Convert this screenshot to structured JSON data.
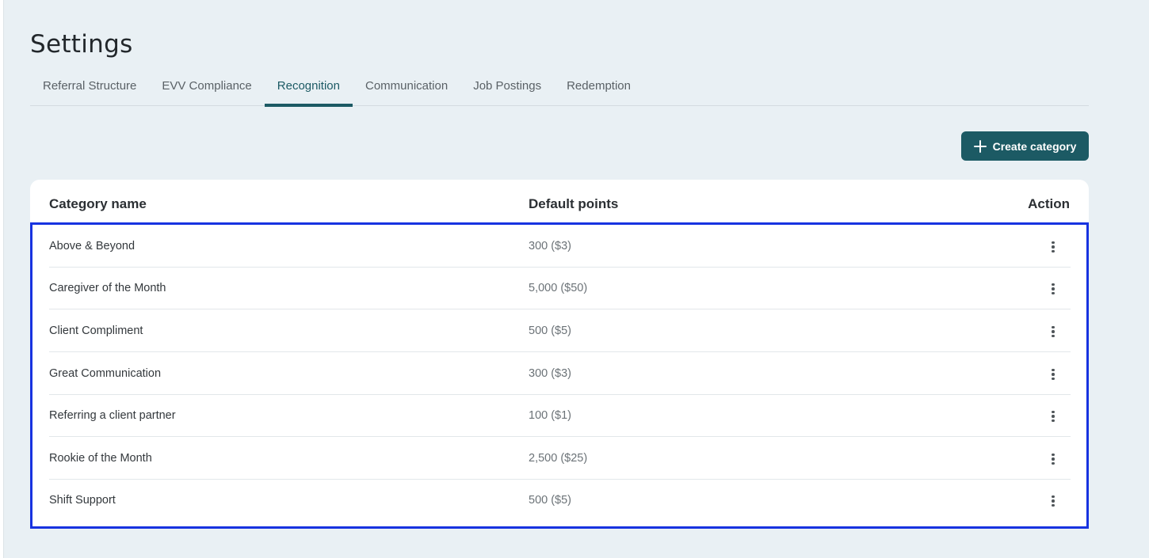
{
  "page": {
    "title": "Settings"
  },
  "tabs": [
    {
      "label": "Referral Structure",
      "active": false
    },
    {
      "label": "EVV Compliance",
      "active": false
    },
    {
      "label": "Recognition",
      "active": true
    },
    {
      "label": "Communication",
      "active": false
    },
    {
      "label": "Job Postings",
      "active": false
    },
    {
      "label": "Redemption",
      "active": false
    }
  ],
  "toolbar": {
    "create_label": "Create category",
    "create_icon": "plus-icon"
  },
  "table": {
    "headers": {
      "name": "Category name",
      "points": "Default points",
      "action": "Action"
    },
    "action_icon": "more-vertical-icon",
    "rows": [
      {
        "name": "Above & Beyond",
        "points": "300 ($3)"
      },
      {
        "name": "Caregiver of the Month",
        "points": "5,000 ($50)"
      },
      {
        "name": "Client Compliment",
        "points": "500 ($5)"
      },
      {
        "name": "Great Communication",
        "points": "300 ($3)"
      },
      {
        "name": "Referring a client partner",
        "points": "100 ($1)"
      },
      {
        "name": "Rookie of the Month",
        "points": "2,500 ($25)"
      },
      {
        "name": "Shift Support",
        "points": "500 ($5)"
      }
    ]
  },
  "colors": {
    "accent": "#1c5a64",
    "background": "#e9f0f4",
    "highlight_border": "#1733e0"
  }
}
